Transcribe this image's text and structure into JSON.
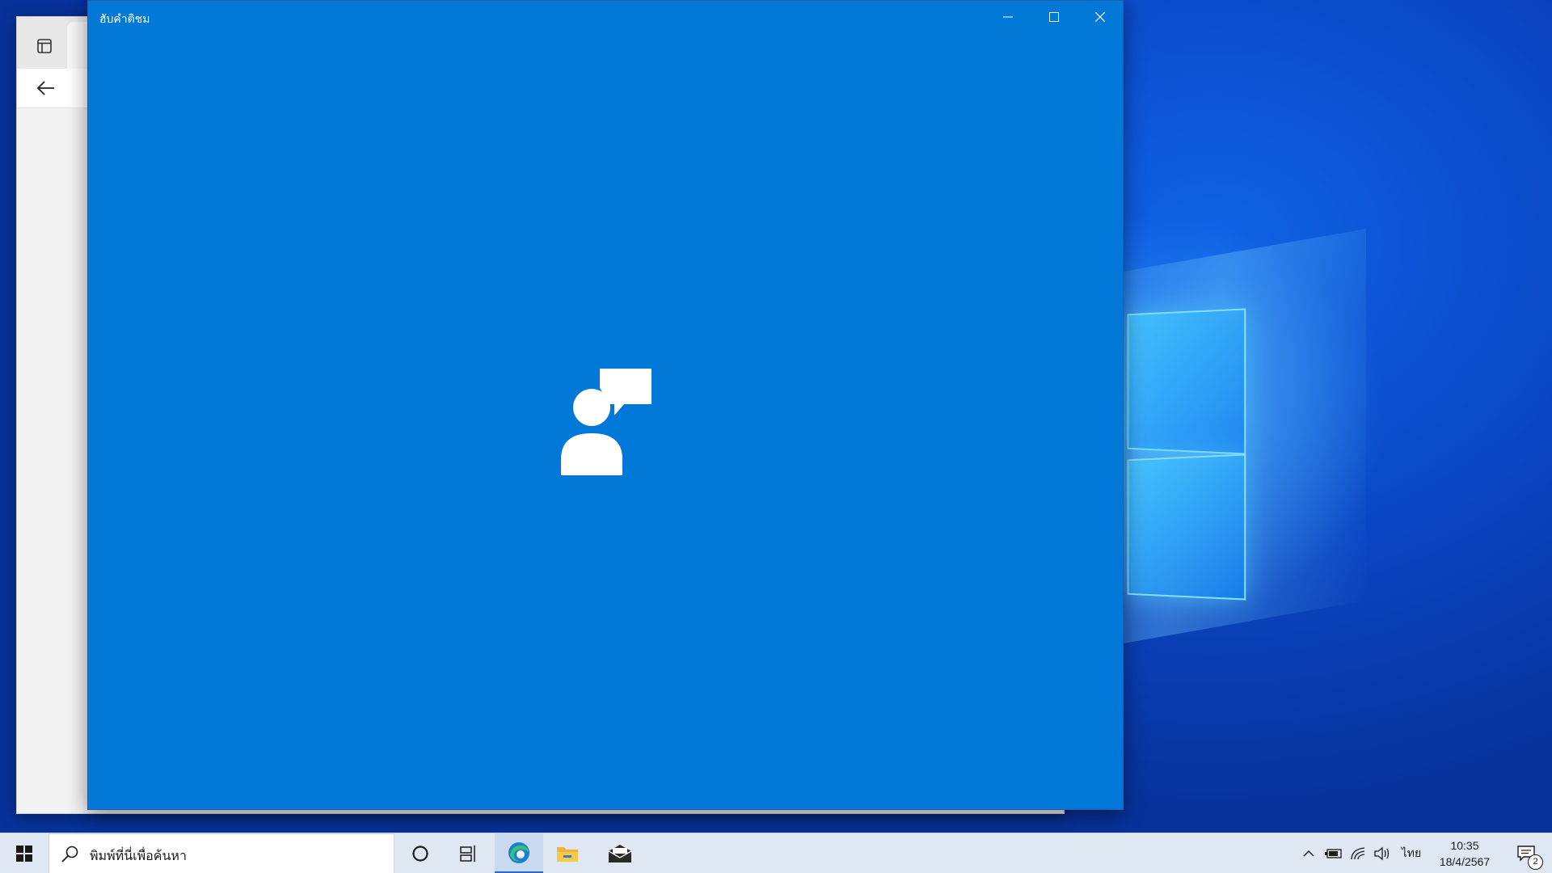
{
  "app_window": {
    "title": "ฮับคำติชม",
    "caption": {
      "minimize": "minimize",
      "maximize": "maximize",
      "close": "close"
    },
    "splash_icon": "feedback-person-speech-icon",
    "background_color": "#0078d7"
  },
  "taskbar": {
    "search_text": "พิมพ์ที่นี่เพื่อค้นหา",
    "pinned": [
      "cortana-icon",
      "task-view-icon",
      "edge-icon",
      "file-explorer-icon",
      "mail-icon"
    ],
    "tray": {
      "language": "ไทย",
      "time": "10:35",
      "date": "18/4/2567",
      "notification_count": "2"
    }
  },
  "colors": {
    "accent": "#0078d7",
    "taskbar": "#dfe7f3"
  }
}
